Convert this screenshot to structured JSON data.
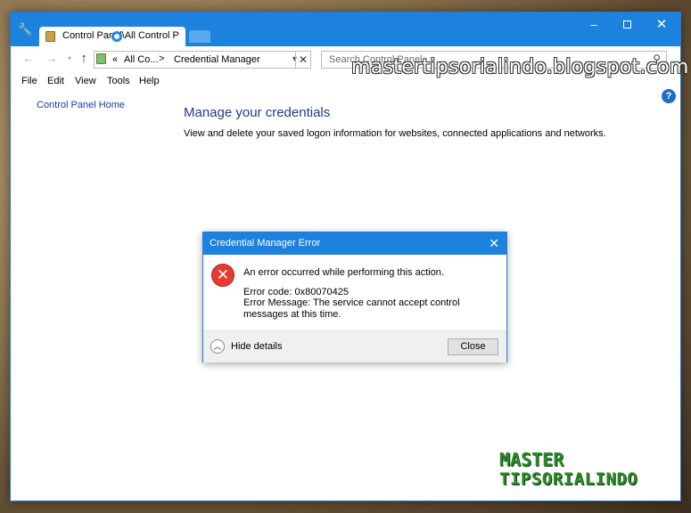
{
  "window": {
    "tab_title": "Control Panel\\All Control P",
    "controls": {
      "minimize": "–",
      "maximize": "",
      "close": "✕"
    }
  },
  "nav": {
    "back": "←",
    "forward": "→",
    "up": "↑",
    "address": {
      "chevrons": "«",
      "segment1": "All Co...",
      "separator": ">",
      "segment2": "Credential Manager"
    },
    "search_placeholder": "Search Control Panel"
  },
  "menu": {
    "file": "File",
    "edit": "Edit",
    "view": "View",
    "tools": "Tools",
    "help": "Help"
  },
  "watermark": "mastertipsorialindo.blogspot.com",
  "sidebar": {
    "home_link": "Control Panel Home"
  },
  "content": {
    "heading": "Manage your credentials",
    "description": "View and delete your saved logon information for websites, connected applications and networks."
  },
  "dialog": {
    "title": "Credential Manager Error",
    "message": "An error occurred while performing this action.",
    "error_code": "Error code: 0x80070425",
    "error_message": "Error Message: The service cannot accept control messages at this time.",
    "hide_details": "Hide details",
    "close_button": "Close"
  },
  "logo": {
    "line1": "MASTER",
    "line2": "TIPSORIALINDO"
  }
}
